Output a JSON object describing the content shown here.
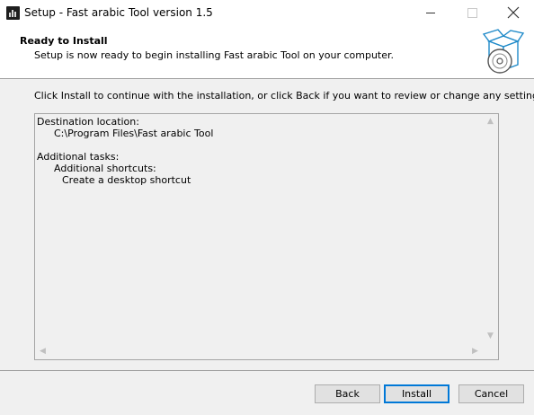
{
  "window": {
    "title": "Setup - Fast arabic Tool version 1.5"
  },
  "header": {
    "title": "Ready to Install",
    "subtitle": "Setup is now ready to begin installing Fast arabic Tool on your computer."
  },
  "main": {
    "instruction": "Click Install to continue with the installation, or click Back if you want to review or change any settings.",
    "memo": {
      "destination_label": "Destination location:",
      "destination_path": "C:\\Program Files\\Fast arabic Tool",
      "tasks_label": "Additional tasks:",
      "shortcuts_label": "Additional shortcuts:",
      "shortcut_task": "Create a desktop shortcut"
    },
    "scroll_arrows": {
      "up": "▲",
      "down": "▼",
      "left": "◀",
      "right": "▶"
    }
  },
  "footer": {
    "back_label": "Back",
    "install_label": "Install",
    "cancel_label": "Cancel"
  },
  "colors": {
    "panel_bg": "#f0f0f0",
    "focus_border": "#0078d7",
    "button_bg": "#e1e1e1"
  },
  "icons": {
    "app": "app-icon",
    "setup_graphic": "setup-box-disc-icon",
    "minimize": "minimize-icon",
    "maximize": "maximize-icon",
    "close": "close-icon"
  }
}
